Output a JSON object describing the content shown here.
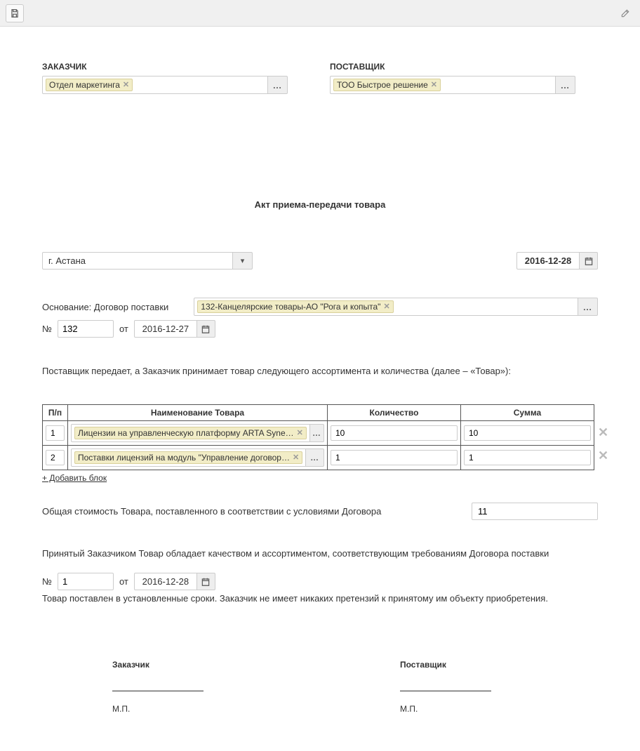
{
  "parties": {
    "customer_label": "ЗАКАЗЧИК",
    "customer_value": "Отдел маркетинга",
    "supplier_label": "ПОСТАВЩИК",
    "supplier_value": "ТОО Быстрое решение"
  },
  "title": "Акт приема-передачи товара",
  "city": "г. Астана",
  "doc_date": "2016-12-28",
  "basis": {
    "label": "Основание: Договор поставки",
    "contract": "132-Канцелярские товары-АО \"Рога и копыта\"",
    "no_label": "№",
    "no_value": "132",
    "from_label": "от",
    "from_date": "2016-12-27"
  },
  "body_text_1": "Поставщик передает, а Заказчик принимает товар следующего ассортимента и количества (далее – «Товар»):",
  "table": {
    "headers": {
      "pp": "П/п",
      "name": "Наименование Товара",
      "qty": "Количество",
      "sum": "Сумма"
    },
    "rows": [
      {
        "pp": "1",
        "name": "Лицензии на управленческую платформу ARTA Syne…",
        "qty": "10",
        "sum": "10"
      },
      {
        "pp": "2",
        "name": "Поставки лицензий на модуль \"Управление договор…",
        "qty": "1",
        "sum": "1"
      }
    ],
    "add_label": "+ Добавить блок"
  },
  "total": {
    "label": "Общая стоимость Товара, поставленного в соответствии с условиями Договора",
    "value": "11"
  },
  "body_text_2": "Принятый Заказчиком Товар обладает качеством и ассортиментом, соответствующим требованиям Договора поставки",
  "accept": {
    "no_label": "№",
    "no_value": "1",
    "from_label": "от",
    "from_date": "2016-12-28"
  },
  "body_text_3": "Товар поставлен в установленные сроки. Заказчик не имеет никаких претензий к принятому им объекту приобретения.",
  "sign": {
    "customer": "Заказчик",
    "supplier": "Поставщик",
    "mp": "М.П."
  },
  "ellipsis": "…",
  "x": "✕",
  "triangle": "▾"
}
